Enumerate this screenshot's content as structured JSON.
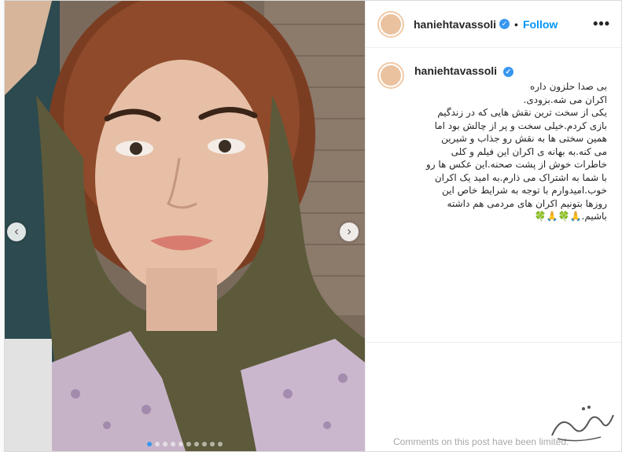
{
  "post": {
    "username": "haniehtavassoli",
    "verified_glyph": "✓",
    "separator": "•",
    "follow_label": "Follow",
    "more_label": "•••",
    "caption_lines": [
      "بی صدا حلزون داره",
      "اکران می شه.بزودی.",
      "یکی از سخت ترین نقش هایی که در زندگیم",
      "بازی کردم.خیلی سخت و پر از چالش بود اما",
      "همین سختی ها به نقش رو جذاب و شیرین",
      "می کنه.به بهانه ی اکران این فیلم و کلی",
      "خاطرات خوش از پشت صحنه.این عکس ها رو",
      "با شما به اشتراک می ذارم.به امید یک اکران",
      "خوب.امیدوارم با توجه به شرایط خاص این",
      "روزها بتونیم اکران های مردمی هم داشته",
      "باشیم.🙏🍀🙏🍀"
    ],
    "comments_limited_text": "Comments on this post have been limited."
  },
  "media": {
    "prev_label": "‹",
    "next_label": "›",
    "dot_count": 10,
    "active_dot": 0
  },
  "colors": {
    "accent": "#0095f6",
    "verified": "#3897f0"
  },
  "icons": {
    "verified": "verified-badge-icon",
    "more": "more-options-icon",
    "prev": "chevron-left-icon",
    "next": "chevron-right-icon"
  }
}
